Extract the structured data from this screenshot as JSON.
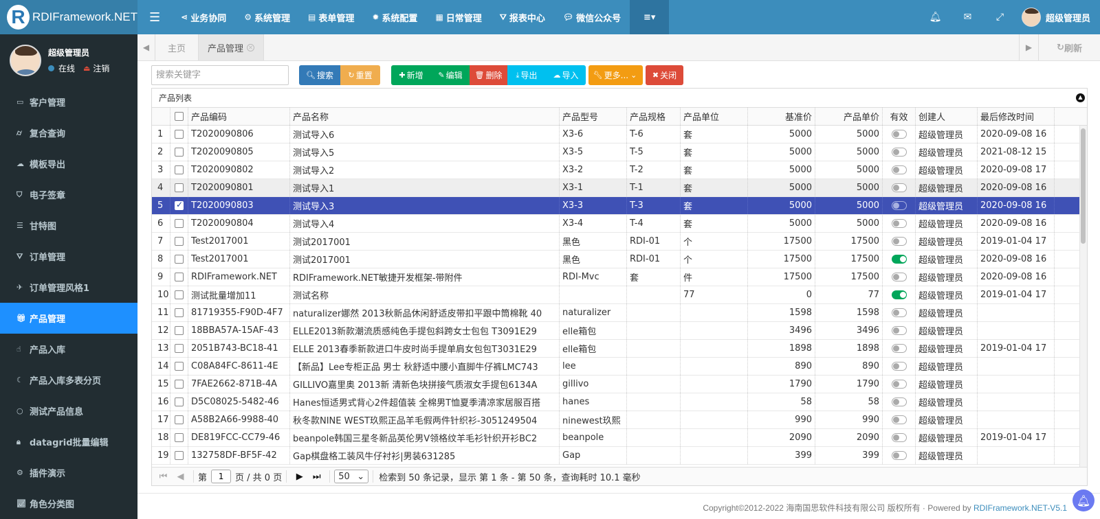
{
  "brand": {
    "logo_letter": "R",
    "name": "RDIFramework.NET"
  },
  "topnav": {
    "burger_icon": "menu-icon",
    "items": [
      {
        "icon": "share-icon",
        "label": "业务协同"
      },
      {
        "icon": "gears-icon",
        "label": "系统管理"
      },
      {
        "icon": "form-icon",
        "label": "表单管理"
      },
      {
        "icon": "gear-icon",
        "label": "系统配置"
      },
      {
        "icon": "calendar-icon",
        "label": "日常管理"
      },
      {
        "icon": "filter-icon",
        "label": "报表中心"
      },
      {
        "icon": "wechat-icon",
        "label": "微信公众号"
      }
    ],
    "more_icon": "list-icon"
  },
  "topright": {
    "user_name": "超级管理员"
  },
  "user_panel": {
    "name": "超级管理员",
    "status": "在线",
    "logout": "注销"
  },
  "sidebar": {
    "items": [
      {
        "icon": "id-card-icon",
        "label": "客户管理",
        "active": false
      },
      {
        "icon": "binoculars-icon",
        "label": "复合查询",
        "active": false
      },
      {
        "icon": "cloud-download-icon",
        "label": "模板导出",
        "active": false
      },
      {
        "icon": "shield-icon",
        "label": "电子签章",
        "active": false
      },
      {
        "icon": "sliders-icon",
        "label": "甘特图",
        "active": false
      },
      {
        "icon": "filter-icon",
        "label": "订单管理",
        "active": false
      },
      {
        "icon": "plane-icon",
        "label": "订单管理风格1",
        "active": false
      },
      {
        "icon": "gift-icon",
        "label": "产品管理",
        "active": true
      },
      {
        "icon": "hand-icon",
        "label": "产品入库",
        "active": false
      },
      {
        "icon": "moon-icon",
        "label": "产品入库多表分页",
        "active": false
      },
      {
        "icon": "circle-icon",
        "label": "测试产品信息",
        "active": false
      },
      {
        "icon": "lock-icon",
        "label": "datagrid批量编辑",
        "active": false
      },
      {
        "icon": "gears-icon",
        "label": "插件演示",
        "active": false
      },
      {
        "icon": "chart-icon",
        "label": "角色分类图",
        "active": false
      }
    ]
  },
  "tabs": {
    "home": "主页",
    "current": "产品管理",
    "refresh": "刷新"
  },
  "toolbar": {
    "search_placeholder": "搜索关键字",
    "search": "搜索",
    "reset": "重置",
    "add": "新增",
    "edit": "编辑",
    "delete": "删除",
    "export": "导出",
    "import": "导入",
    "more": "更多...",
    "close": "关闭"
  },
  "grid": {
    "title": "产品列表",
    "columns": [
      "产品编码",
      "产品名称",
      "产品型号",
      "产品规格",
      "产品单位",
      "基准价",
      "产品单价",
      "有效",
      "创建人",
      "最后修改时间"
    ],
    "rows": [
      {
        "no": "1",
        "code": "T2020090806",
        "name": "测试导入6",
        "model": "X3-6",
        "spec": "T-6",
        "unit": "套",
        "base": "5000",
        "price": "5000",
        "valid": false,
        "creator": "超级管理员",
        "time": "2020-09-08 16"
      },
      {
        "no": "2",
        "code": "T2020090805",
        "name": "测试导入5",
        "model": "X3-5",
        "spec": "T-5",
        "unit": "套",
        "base": "5000",
        "price": "5000",
        "valid": false,
        "creator": "超级管理员",
        "time": "2021-08-12 15"
      },
      {
        "no": "3",
        "code": "T2020090802",
        "name": "测试导入2",
        "model": "X3-2",
        "spec": "T-2",
        "unit": "套",
        "base": "5000",
        "price": "5000",
        "valid": false,
        "creator": "超级管理员",
        "time": "2020-09-08 17"
      },
      {
        "no": "4",
        "code": "T2020090801",
        "name": "测试导入1",
        "model": "X3-1",
        "spec": "T-1",
        "unit": "套",
        "base": "5000",
        "price": "5000",
        "valid": false,
        "creator": "超级管理员",
        "time": "2020-09-08 16"
      },
      {
        "no": "5",
        "code": "T2020090803",
        "name": "测试导入3",
        "model": "X3-3",
        "spec": "T-3",
        "unit": "套",
        "base": "5000",
        "price": "5000",
        "valid": false,
        "creator": "超级管理员",
        "time": "2020-09-08 16"
      },
      {
        "no": "6",
        "code": "T2020090804",
        "name": "测试导入4",
        "model": "X3-4",
        "spec": "T-4",
        "unit": "套",
        "base": "5000",
        "price": "5000",
        "valid": false,
        "creator": "超级管理员",
        "time": "2020-09-08 16"
      },
      {
        "no": "7",
        "code": "Test2017001",
        "name": "测试2017001",
        "model": "黑色",
        "spec": "RDI-01",
        "unit": "个",
        "base": "17500",
        "price": "17500",
        "valid": false,
        "creator": "超级管理员",
        "time": "2019-01-04 17"
      },
      {
        "no": "8",
        "code": "Test2017001",
        "name": "测试2017001",
        "model": "黑色",
        "spec": "RDI-01",
        "unit": "个",
        "base": "17500",
        "price": "17500",
        "valid": true,
        "creator": "超级管理员",
        "time": "2020-09-08 16"
      },
      {
        "no": "9",
        "code": "RDIFramework.NET",
        "name": "RDIFramework.NET敏捷开发框架-带附件",
        "model": "RDI-Mvc",
        "spec": "套",
        "unit": "件",
        "base": "17500",
        "price": "17500",
        "valid": false,
        "creator": "超级管理员",
        "time": "2020-09-08 16"
      },
      {
        "no": "10",
        "code": "测试批量增加11",
        "name": "测试名称",
        "model": "",
        "spec": "",
        "unit": "77",
        "base": "0",
        "price": "77",
        "valid": true,
        "creator": "超级管理员",
        "time": "2019-01-04 17"
      },
      {
        "no": "11",
        "code": "81719355-F90D-4F7",
        "name": "naturalizer娜然 2013秋新品休闲舒适皮带扣平跟中筒棉靴 40",
        "model": "naturalizer",
        "spec": "",
        "unit": "",
        "base": "1598",
        "price": "1598",
        "valid": false,
        "creator": "超级管理员",
        "time": ""
      },
      {
        "no": "12",
        "code": "18BBA57A-15AF-43",
        "name": "ELLE2013新款潮流质感纯色手提包斜跨女士包包 T3091E29",
        "model": "elle箱包",
        "spec": "",
        "unit": "",
        "base": "3496",
        "price": "3496",
        "valid": false,
        "creator": "超级管理员",
        "time": ""
      },
      {
        "no": "13",
        "code": "2051B743-BC18-41",
        "name": "ELLE 2013春季新款进口牛皮时尚手提单肩女包包T3031E29",
        "model": "elle箱包",
        "spec": "",
        "unit": "",
        "base": "1898",
        "price": "1898",
        "valid": false,
        "creator": "超级管理员",
        "time": "2019-01-04 17"
      },
      {
        "no": "14",
        "code": "C08A84FC-8611-4E",
        "name": "【新品】Lee专柜正品 男士 秋舒适中腰小直脚牛仔裤LMC743",
        "model": "lee",
        "spec": "",
        "unit": "",
        "base": "890",
        "price": "890",
        "valid": false,
        "creator": "超级管理员",
        "time": ""
      },
      {
        "no": "15",
        "code": "7FAE2662-871B-4A",
        "name": "GILLIVO嘉里奥 2013新 清新色块拼接气质淑女手提包6134A",
        "model": "gillivo",
        "spec": "",
        "unit": "",
        "base": "1790",
        "price": "1790",
        "valid": false,
        "creator": "超级管理员",
        "time": ""
      },
      {
        "no": "16",
        "code": "D5C08025-5482-46",
        "name": "Hanes恒适男式背心2件超值装 全棉男T恤夏季清凉家居服百搭",
        "model": "hanes",
        "spec": "",
        "unit": "",
        "base": "58",
        "price": "58",
        "valid": false,
        "creator": "超级管理员",
        "time": ""
      },
      {
        "no": "17",
        "code": "A58B2A66-9988-40",
        "name": "秋冬款NINE WEST玖熙正品羊毛假两件针织衫-3051249504",
        "model": "ninewest玖熙",
        "spec": "",
        "unit": "",
        "base": "990",
        "price": "990",
        "valid": false,
        "creator": "超级管理员",
        "time": ""
      },
      {
        "no": "18",
        "code": "DE819FCC-CC79-46",
        "name": "beanpole韩国三星冬新品英伦男V领格纹羊毛衫针织开衫BC2",
        "model": "beanpole",
        "spec": "",
        "unit": "",
        "base": "2090",
        "price": "2090",
        "valid": false,
        "creator": "超级管理员",
        "time": "2019-01-04 17"
      },
      {
        "no": "19",
        "code": "132758DF-BF5F-42",
        "name": "Gap棋盘格工装风牛仔衬衫|男装631285",
        "model": "Gap",
        "spec": "",
        "unit": "",
        "base": "399",
        "price": "399",
        "valid": false,
        "creator": "超级管理员",
        "time": ""
      }
    ],
    "hover_row": 3,
    "selected_row": 4
  },
  "pager": {
    "page_prefix": "第",
    "page_value": "1",
    "page_suffix": "页 / 共 0 页",
    "page_size": "50",
    "info": "检索到 50 条记录，显示 第 1 条 - 第 50 条，查询耗时 10.1 毫秒"
  },
  "footer": {
    "copyright": "Copyright©2012-2022 海南国思软件科技有限公司 版权所有 · Powered by ",
    "link": "RDIFramework.NET-V5.1"
  }
}
